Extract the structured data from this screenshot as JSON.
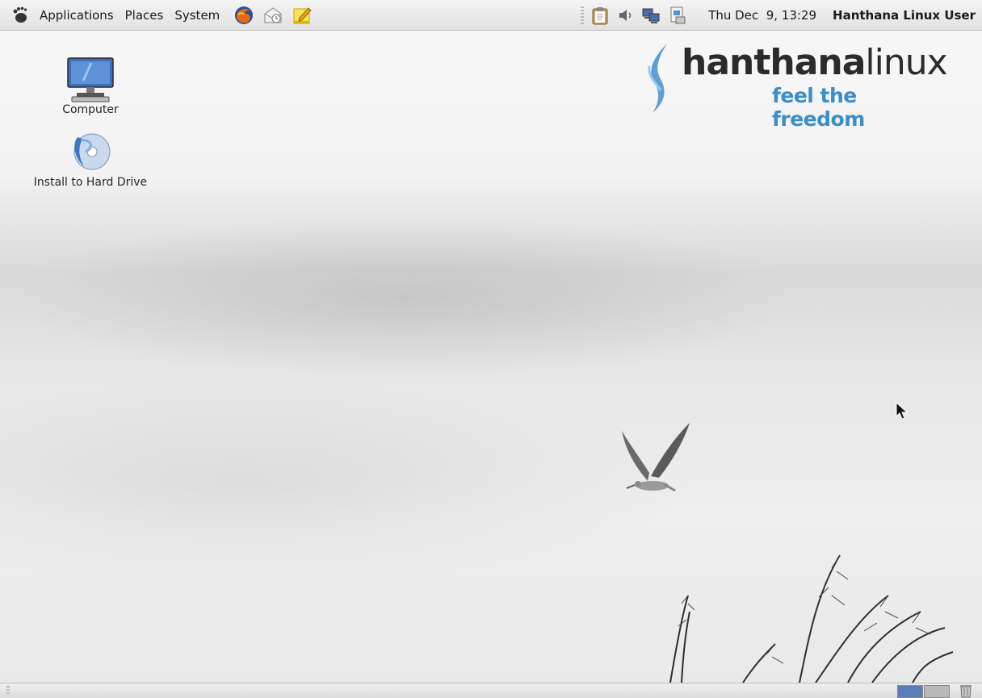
{
  "top_panel": {
    "menus": [
      "Applications",
      "Places",
      "System"
    ],
    "launchers": [
      "firefox-icon",
      "evolution-mail-icon",
      "notes-icon"
    ],
    "tray": [
      "clipboard-icon",
      "volume-icon",
      "network-icon",
      "updates-icon"
    ],
    "clock": "Thu Dec  9, 13:29",
    "user": "Hanthana Linux User"
  },
  "desktop": {
    "icons": [
      {
        "label": "Computer",
        "icon": "computer-icon"
      },
      {
        "label": "Install to Hard Drive",
        "icon": "install-disc-icon"
      }
    ],
    "logo": {
      "name_bold": "hanthana",
      "name_light": "linux",
      "tagline": "feel the freedom"
    }
  },
  "bottom_panel": {
    "workspaces": 2,
    "active_workspace": 1
  },
  "colors": {
    "accent": "#3b8ec8",
    "workspace_active": "#5a7fb8"
  }
}
